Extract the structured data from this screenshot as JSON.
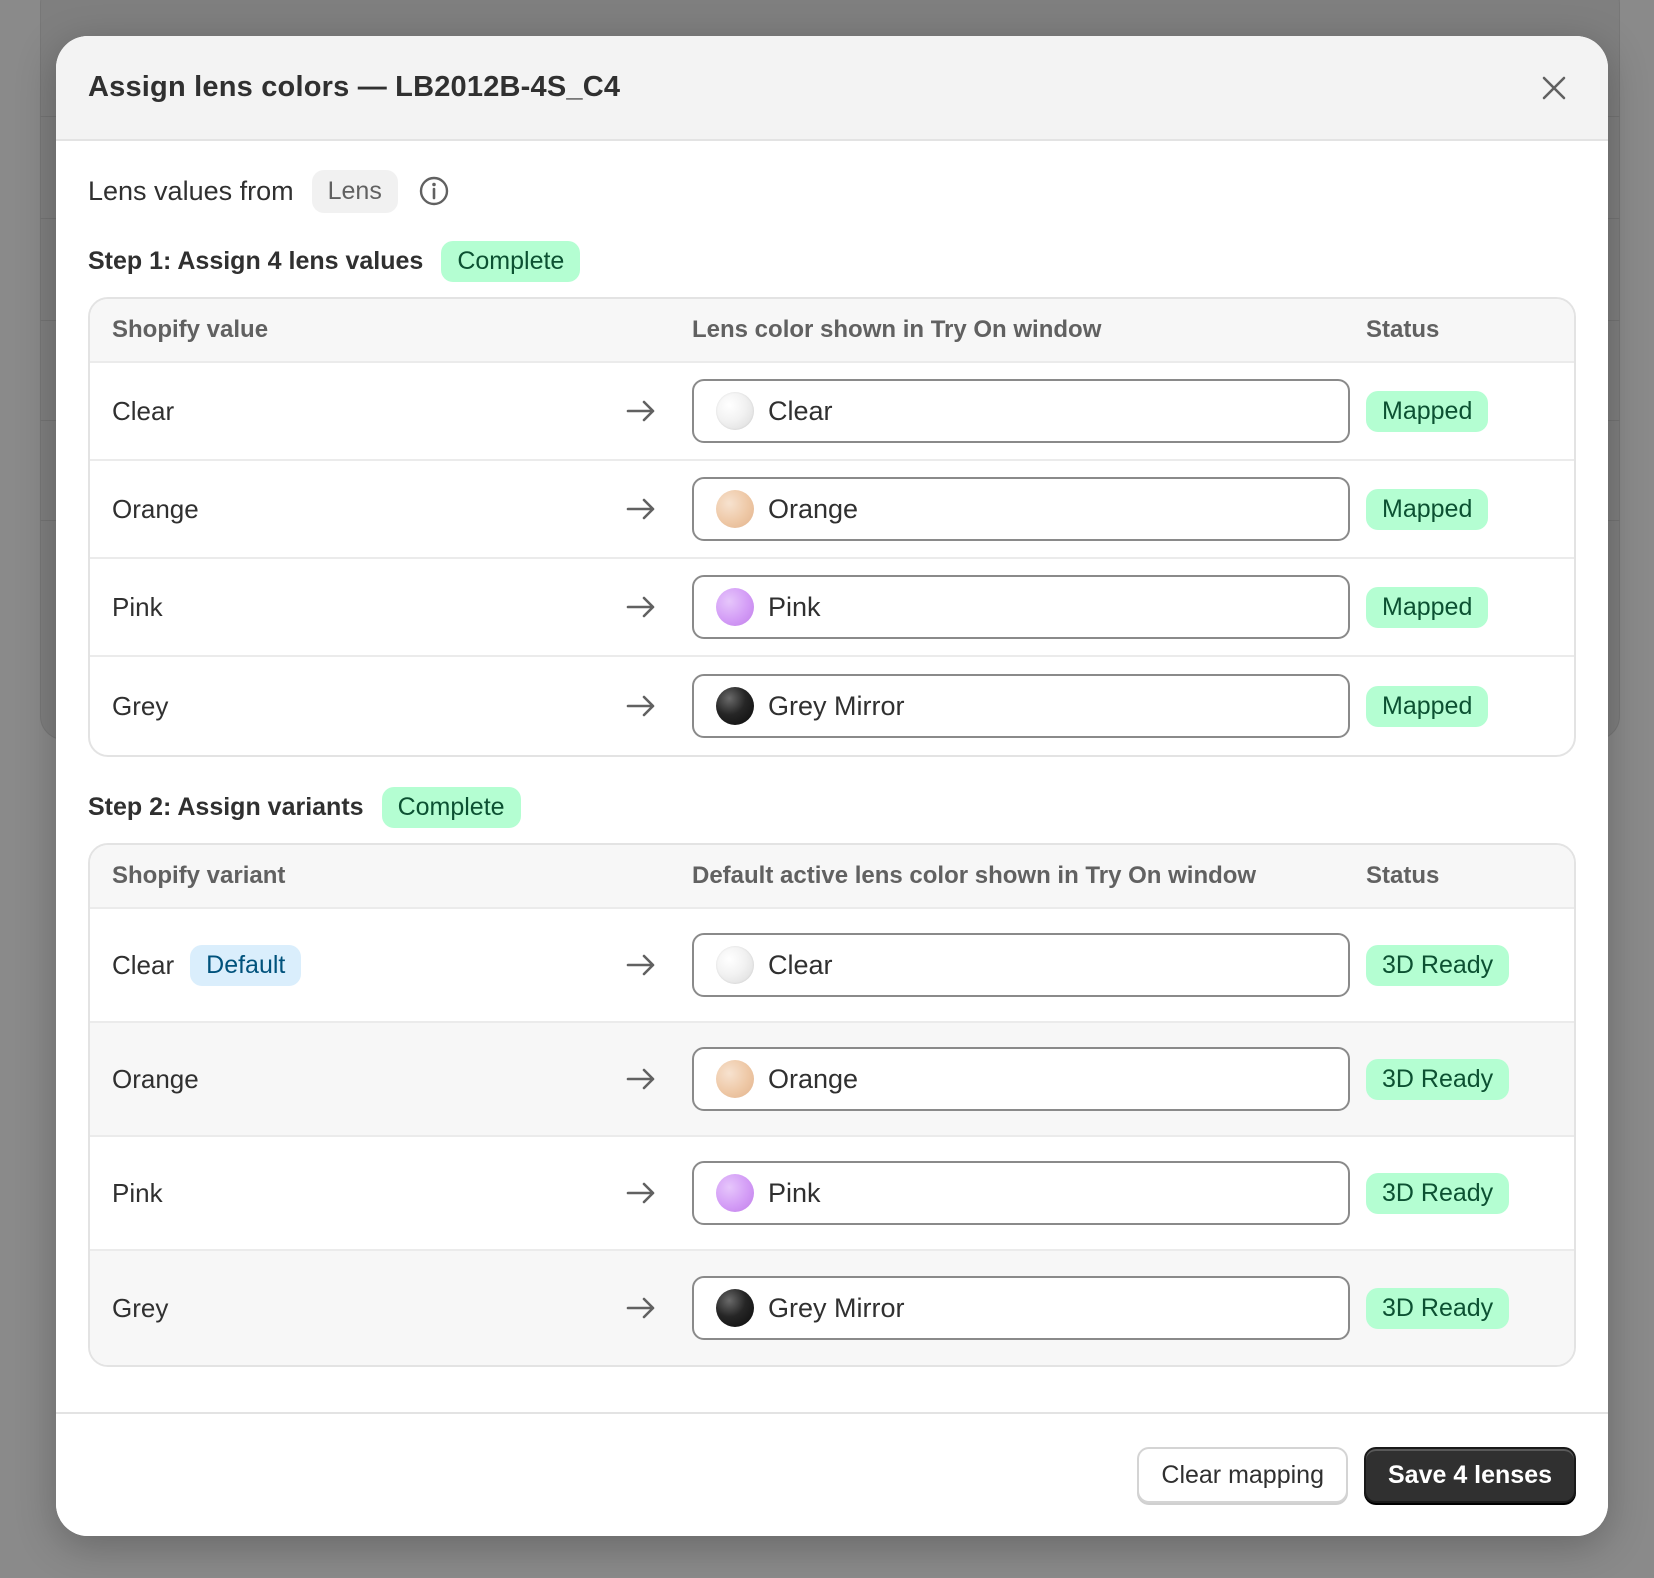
{
  "modal": {
    "title": "Assign lens colors — LB2012B-4S_C4",
    "source_label": "Lens values from",
    "source_value": "Lens"
  },
  "step1": {
    "title": "Step 1: Assign 4 lens values",
    "badge": "Complete",
    "headers": [
      "Shopify value",
      "Lens color shown in Try On window",
      "Status"
    ],
    "rows": [
      {
        "value": "Clear",
        "lens": "Clear",
        "swatch": "clear",
        "status": "Mapped"
      },
      {
        "value": "Orange",
        "lens": "Orange",
        "swatch": "orange",
        "status": "Mapped"
      },
      {
        "value": "Pink",
        "lens": "Pink",
        "swatch": "pink",
        "status": "Mapped"
      },
      {
        "value": "Grey",
        "lens": "Grey Mirror",
        "swatch": "grey",
        "status": "Mapped"
      }
    ]
  },
  "step2": {
    "title": "Step 2: Assign variants",
    "badge": "Complete",
    "headers": [
      "Shopify variant",
      "Default active lens color shown in Try On window",
      "Status"
    ],
    "rows": [
      {
        "variant": "Clear",
        "default_badge": "Default",
        "lens": "Clear",
        "swatch": "clear",
        "status": "3D Ready"
      },
      {
        "variant": "Orange",
        "lens": "Orange",
        "swatch": "orange",
        "status": "3D Ready"
      },
      {
        "variant": "Pink",
        "lens": "Pink",
        "swatch": "pink",
        "status": "3D Ready"
      },
      {
        "variant": "Grey",
        "lens": "Grey Mirror",
        "swatch": "grey",
        "status": "3D Ready"
      }
    ]
  },
  "footer": {
    "secondary_label": "Clear mapping",
    "primary_label": "Save 4 lenses"
  },
  "icons": {
    "close": "close-icon",
    "info": "info-icon",
    "arrow": "arrow-right-icon"
  },
  "colors": {
    "badge_success_bg": "#b4fed2",
    "badge_success_text": "#0c5132",
    "badge_info_bg": "#daeefc",
    "primary_button": "#303030"
  }
}
